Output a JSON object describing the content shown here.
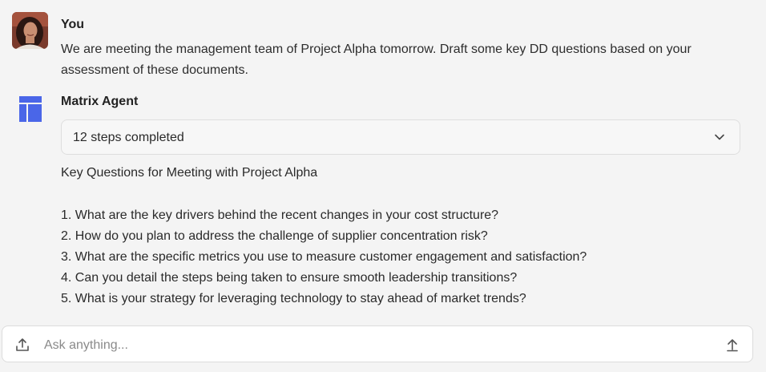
{
  "user_message": {
    "sender": "You",
    "text": "We are meeting the management team of Project Alpha tomorrow. Draft some key DD questions based on your assessment of these documents."
  },
  "agent_message": {
    "sender": "Matrix Agent",
    "steps_label": "12 steps completed",
    "title": "Key Questions for Meeting with Project Alpha",
    "questions": [
      "1. What are the key drivers behind the recent changes in your cost structure?",
      "2. How do you plan to address the challenge of supplier concentration risk?",
      "3. What are the specific metrics you use to measure customer engagement and satisfaction?",
      "4. Can you detail the steps being taken to ensure smooth leadership transitions?",
      "5. What is your strategy for leveraging technology to stay ahead of market trends?"
    ]
  },
  "composer": {
    "placeholder": "Ask anything..."
  },
  "icons": {
    "avatar": "user-avatar-photo",
    "agent": "matrix-agent-icon",
    "expand": "chevron-down-icon",
    "attach": "upload-icon",
    "send": "send-arrow-icon"
  },
  "colors": {
    "agent_icon": "#4a66e8",
    "background": "#f4f4f4"
  }
}
